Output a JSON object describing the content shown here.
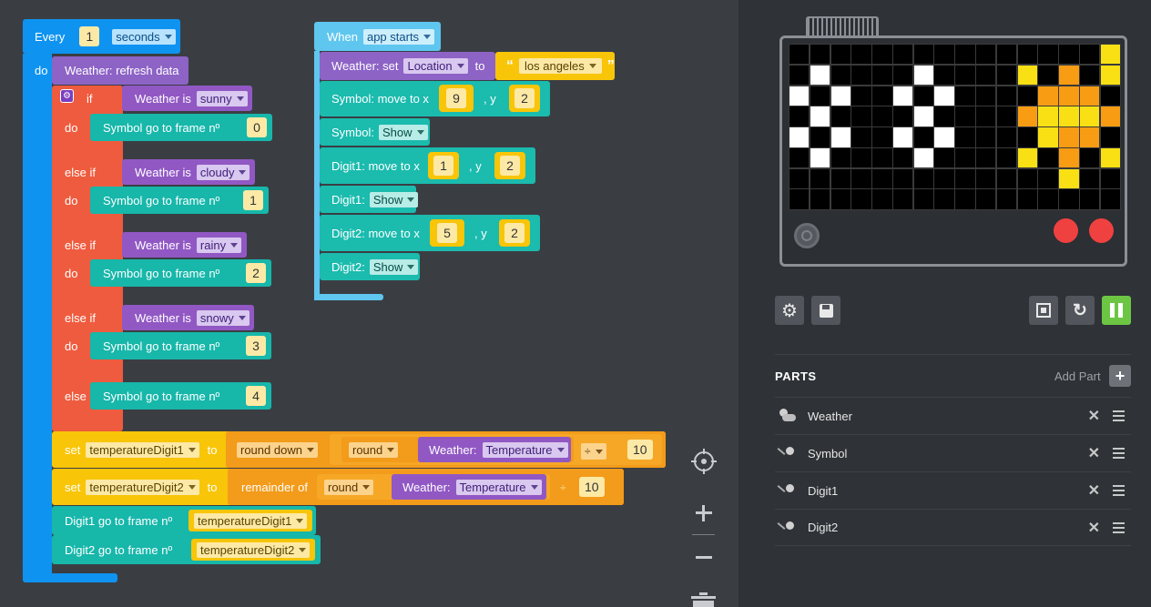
{
  "every_block": {
    "every": "Every",
    "interval": "1",
    "unit": "seconds",
    "do": "do"
  },
  "refresh": "Weather: refresh data",
  "ifelse": {
    "if": "if",
    "else_if": "else if",
    "do": "do",
    "else": "else",
    "weather_is": "Weather is",
    "conditions": [
      "sunny",
      "cloudy",
      "rainy",
      "snowy"
    ],
    "symbol_goto": "Symbol go to frame nº",
    "frames": [
      "0",
      "1",
      "2",
      "3",
      "4"
    ]
  },
  "set1": {
    "set": "set",
    "var": "temperatureDigit1",
    "to": "to",
    "op": "round down",
    "round": "round",
    "weather": "Weather:",
    "prop": "Temperature",
    "div": "÷",
    "divisor": "10"
  },
  "set2": {
    "set": "set",
    "var": "temperatureDigit2",
    "to": "to",
    "op": "remainder of",
    "round": "round",
    "weather": "Weather:",
    "prop": "Temperature",
    "div": "÷",
    "divisor": "10"
  },
  "digit_goto": [
    {
      "label": "Digit1 go to frame nº",
      "var": "temperatureDigit1"
    },
    {
      "label": "Digit2 go to frame nº",
      "var": "temperatureDigit2"
    }
  ],
  "app_starts": {
    "when": "When",
    "event": "app starts",
    "weather_set": "Weather: set",
    "location_prop": "Location",
    "to": "to",
    "location_value": "los angeles",
    "quote_open": "“",
    "quote_close": "”",
    "symbol_move": "Symbol: move to x",
    "symbol_x": "9",
    "y_label": ", y",
    "symbol_y": "2",
    "symbol_show_label": "Symbol:",
    "show": "Show",
    "digit1_move": "Digit1: move to x",
    "digit1_x": "1",
    "digit1_y": "2",
    "digit1_show_label": "Digit1:",
    "digit2_move": "Digit2: move to x",
    "digit2_x": "5",
    "digit2_y": "2",
    "digit2_show_label": "Digit2:"
  },
  "parts": {
    "title": "PARTS",
    "add_part": "Add Part",
    "items": [
      {
        "name": "Weather",
        "icon": "weather-icon"
      },
      {
        "name": "Symbol",
        "icon": "sprite-icon"
      },
      {
        "name": "Digit1",
        "icon": "sprite-icon"
      },
      {
        "name": "Digit2",
        "icon": "sprite-icon"
      }
    ]
  },
  "colors": {
    "event": "#0f93f0",
    "weather": "#9158c4",
    "control": "#ef5b3e",
    "sprite": "#17b7aa",
    "variable": "#f8c508",
    "math": "#f39b1a",
    "run": "#6cc644"
  },
  "matrix_rows": [
    "000000000000000y",
    "0w0000w0000y0o0y",
    "w0w00w0w0000ooo0",
    "0w0000w0000oyyyo",
    "w0w00w0w0000yoo0",
    "0w0000w0000y0o0y",
    "0000000000000y00",
    "0000000000000000"
  ]
}
